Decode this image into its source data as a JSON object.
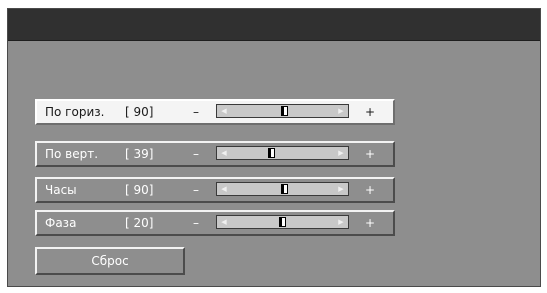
{
  "rows": [
    {
      "label": "По гориз.",
      "value": "[ 90]",
      "minus": "–",
      "plus": "+",
      "level": 0.52,
      "selected": true
    },
    {
      "label": "По верт.",
      "value": "[ 39]",
      "minus": "–",
      "plus": "+",
      "level": 0.39,
      "selected": false
    },
    {
      "label": "Часы",
      "value": "[ 90]",
      "minus": "–",
      "plus": "+",
      "level": 0.52,
      "selected": false
    },
    {
      "label": "Фаза",
      "value": "[ 20]",
      "minus": "–",
      "plus": "+",
      "level": 0.5,
      "selected": false
    }
  ],
  "arrows": {
    "left": "◀",
    "right": "▶"
  },
  "reset": {
    "label": "Сброс"
  },
  "colors": {
    "panel": "#8e8e8e",
    "titlebar": "#303030",
    "selected_row": "#f4f4f4"
  }
}
